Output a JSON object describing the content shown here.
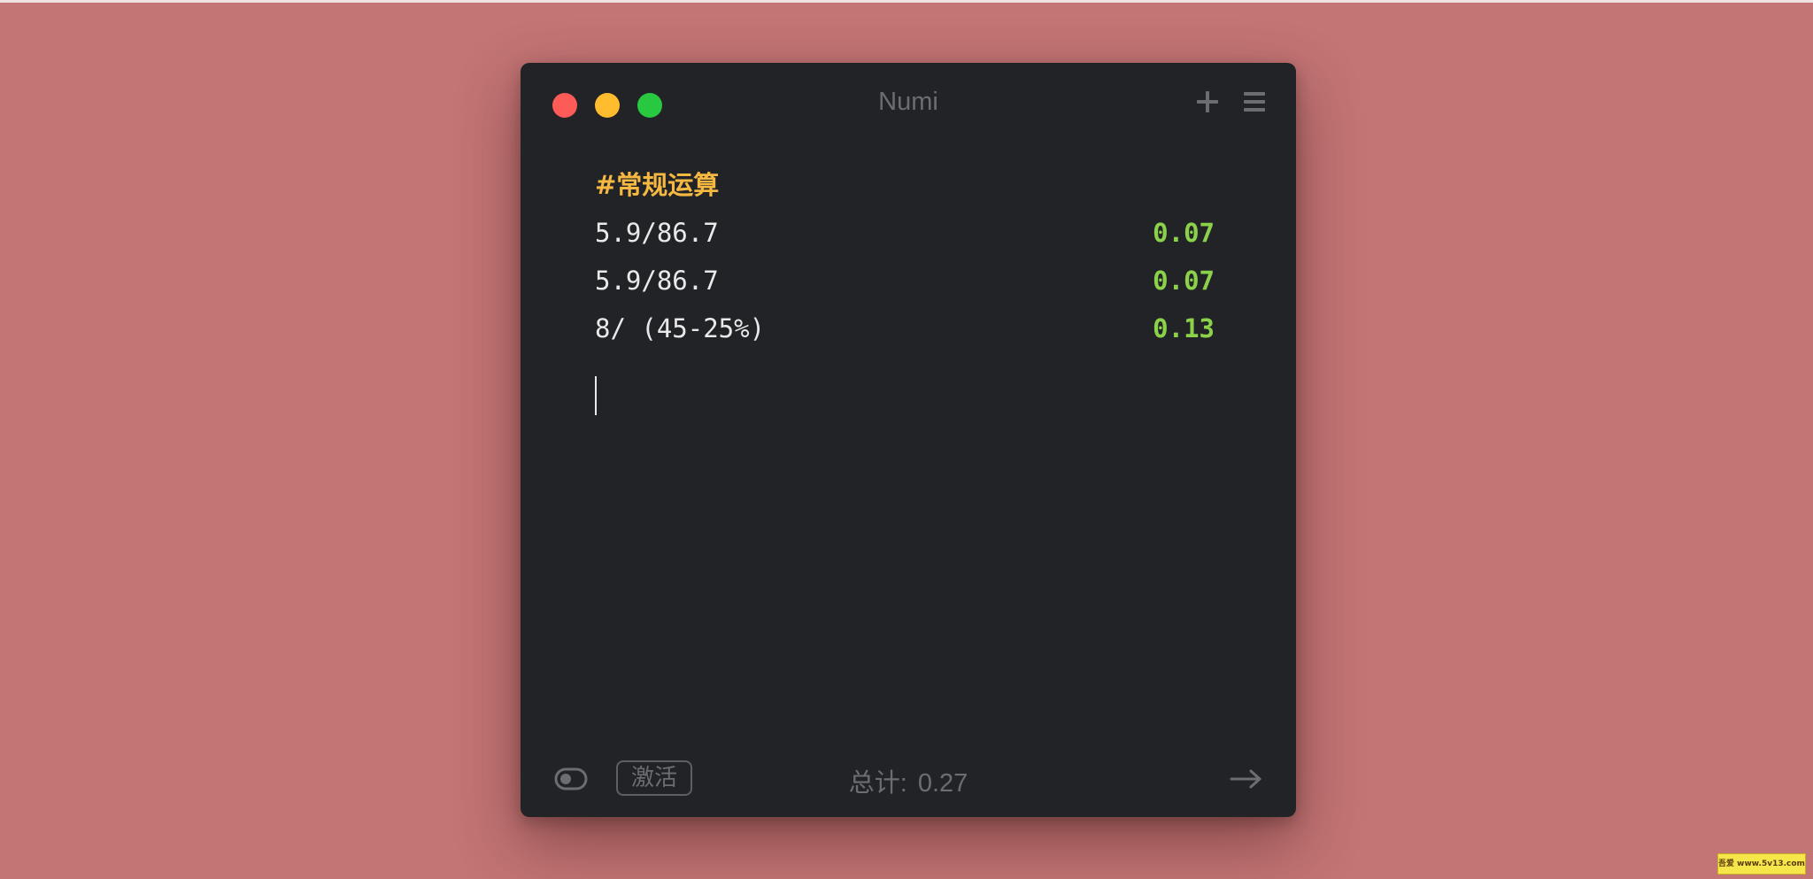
{
  "window": {
    "title": "Numi"
  },
  "editor": {
    "lines": [
      {
        "expression": "#常规运算",
        "result": ""
      },
      {
        "expression": "5.9/86.7",
        "result": "0.07"
      },
      {
        "expression": "5.9/86.7",
        "result": "0.07"
      },
      {
        "expression": "8/ (45-25%)",
        "result": "0.13"
      }
    ]
  },
  "footer": {
    "activate_label": "激活",
    "total_label": "总计:",
    "total_value": "0.27"
  },
  "watermark": {
    "text": "吾爱 www.5v13.com"
  },
  "icons": {
    "close": "close-dot",
    "minimize": "minimize-dot",
    "maximize": "maximize-dot",
    "plus": "plus-icon",
    "menu": "hamburger-menu-icon",
    "toggle": "toggle-icon",
    "arrow": "arrow-right-icon"
  },
  "colors": {
    "background": "#c37474",
    "window": "#222327",
    "heading": "#f5b841",
    "result": "#8bd14a",
    "text": "#e9e9ea",
    "muted": "#6c6d72"
  }
}
